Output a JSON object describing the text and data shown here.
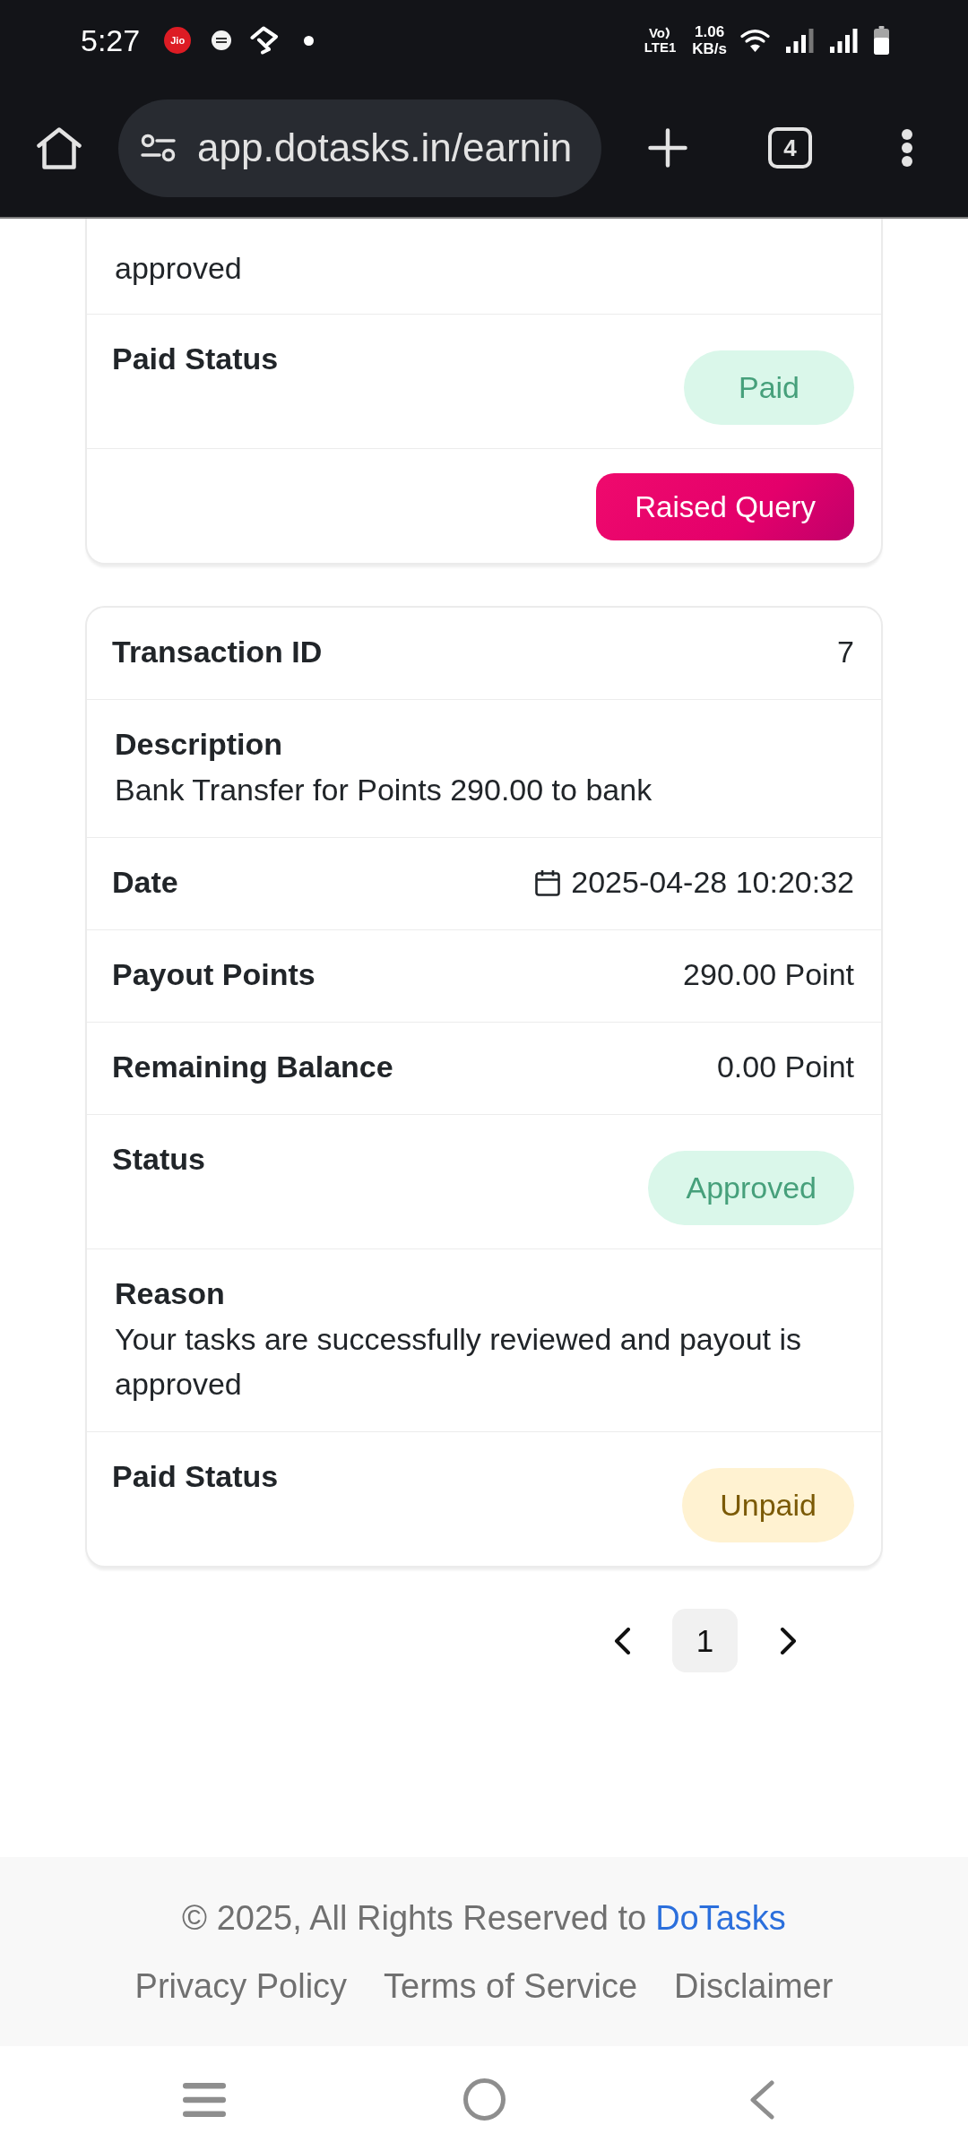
{
  "status_bar": {
    "time": "5:27",
    "carrier_logo": "Jio",
    "volte": "Vo",
    "network": "LTE1",
    "net_speed": {
      "value": "1.06",
      "unit": "KB/s"
    }
  },
  "browser": {
    "url": "app.dotasks.in/earnin",
    "tab_count": "4"
  },
  "transactions": [
    {
      "rows": [
        {
          "kind": "text",
          "value": "approved"
        },
        {
          "kind": "badge",
          "label": "Paid Status",
          "value": "Paid",
          "color": "#46a07b"
        }
      ],
      "action": "Raised Query"
    },
    {
      "rows": [
        {
          "kind": "pair",
          "label": "Transaction ID",
          "value": "7"
        },
        {
          "kind": "stacked",
          "label": "Description",
          "value": "Bank Transfer for Points 290.00 to bank"
        },
        {
          "kind": "date",
          "label": "Date",
          "value": "2025-04-28 10:20:32"
        },
        {
          "kind": "pair",
          "label": "Payout Points",
          "value": "290.00 Point"
        },
        {
          "kind": "pair",
          "label": "Remaining Balance",
          "value": "0.00 Point"
        },
        {
          "kind": "badge",
          "label": "Status",
          "value": "Approved",
          "color": "#46a07b"
        },
        {
          "kind": "stacked",
          "label": "Reason",
          "value": "Your tasks are successfully reviewed and payout is approved"
        },
        {
          "kind": "badge",
          "label": "Paid Status",
          "value": "Unpaid",
          "color": "#7b5a06"
        }
      ]
    }
  ],
  "pagination": {
    "pages": [
      {
        "label": "1",
        "selected": true
      }
    ]
  },
  "footer": {
    "copyright": "© 2025, All Rights Reserved to",
    "brand_link": "DoTasks",
    "links": [
      "Privacy Policy",
      "Terms of Service",
      "Disclaimer"
    ]
  }
}
